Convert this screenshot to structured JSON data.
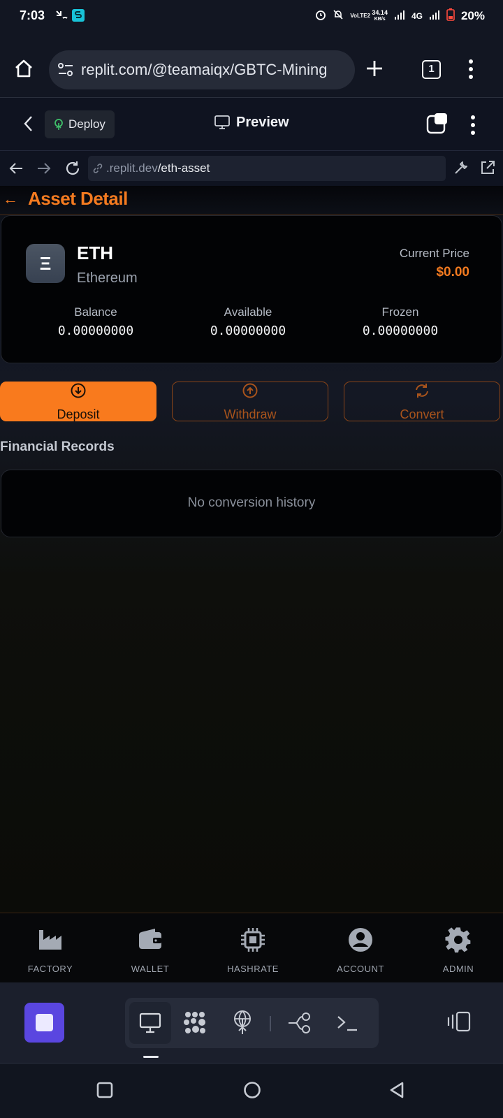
{
  "status_bar": {
    "time": "7:03",
    "data_speed_top": "34.14",
    "data_speed_bottom": "KB/s",
    "volte": "VoLTE2",
    "network": "4G",
    "battery": "20%"
  },
  "browser": {
    "url": "replit.com/@teamaiqx/GBTC-Mining",
    "tab_count": "1"
  },
  "replit_header": {
    "deploy_label": "Deploy",
    "preview_label": "Preview"
  },
  "preview_nav": {
    "url_prefix": ".replit.dev",
    "url_path": "/eth-asset"
  },
  "app": {
    "back_symbol": "←",
    "title": "Asset Detail",
    "asset": {
      "icon_glyph": "Ξ",
      "symbol": "ETH",
      "name": "Ethereum",
      "price_label": "Current Price",
      "price_value": "$0.00"
    },
    "stats": [
      {
        "label": "Balance",
        "value": "0.00000000"
      },
      {
        "label": "Available",
        "value": "0.00000000"
      },
      {
        "label": "Frozen",
        "value": "0.00000000"
      }
    ],
    "actions": {
      "deposit": "Deposit",
      "withdraw": "Withdraw",
      "convert": "Convert"
    },
    "records": {
      "heading": "Financial Records",
      "empty_text": "No conversion history"
    },
    "nav": [
      {
        "label": "FACTORY",
        "icon": "factory-icon"
      },
      {
        "label": "WALLET",
        "icon": "wallet-icon"
      },
      {
        "label": "HASHRATE",
        "icon": "chip-icon"
      },
      {
        "label": "ACCOUNT",
        "icon": "account-icon"
      },
      {
        "label": "ADMIN",
        "icon": "gear-icon"
      }
    ]
  },
  "colors": {
    "accent": "#f47b20",
    "deposit_bg": "#f97a1d",
    "stop_button": "#5a46e0"
  }
}
